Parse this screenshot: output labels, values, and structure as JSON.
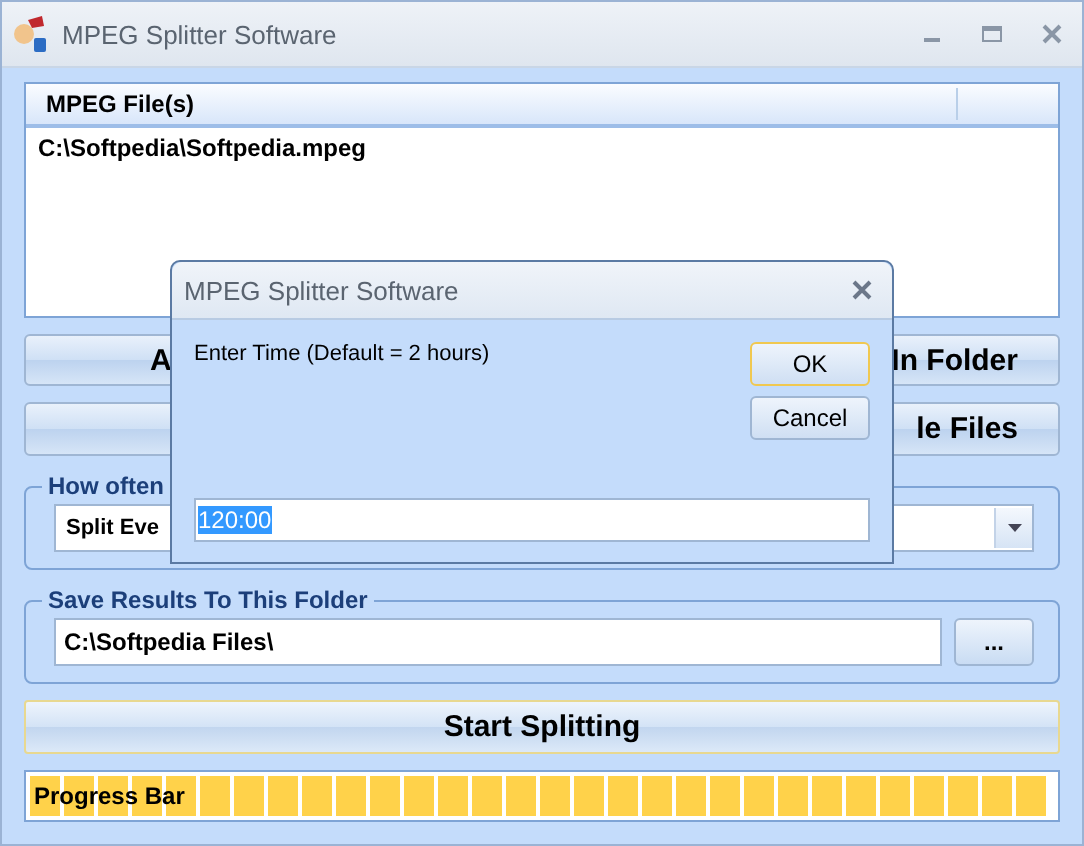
{
  "window": {
    "title": "MPEG Splitter Software"
  },
  "file_list": {
    "column": "MPEG File(s)",
    "rows": [
      "C:\\Softpedia\\Softpedia.mpeg"
    ]
  },
  "action_buttons": [
    {
      "label_start": "A",
      "label_end": "In Folder"
    },
    {
      "label_end": "le Files"
    }
  ],
  "split_group": {
    "legend": "How often",
    "combo_value": "Split Eve"
  },
  "save_group": {
    "legend": "Save Results To This Folder",
    "folder": "C:\\Softpedia Files\\",
    "browse_button": "..."
  },
  "start_button": "Start Splitting",
  "progress": {
    "label": "Progress Bar",
    "level": 1
  },
  "dialog": {
    "title": "MPEG Splitter Software",
    "prompt": "Enter Time (Default = 2 hours)",
    "input_value": "120:00",
    "input_selected": true,
    "buttons": [
      {
        "label": "OK",
        "default": true
      },
      {
        "label": "Cancel",
        "default": false
      }
    ]
  }
}
